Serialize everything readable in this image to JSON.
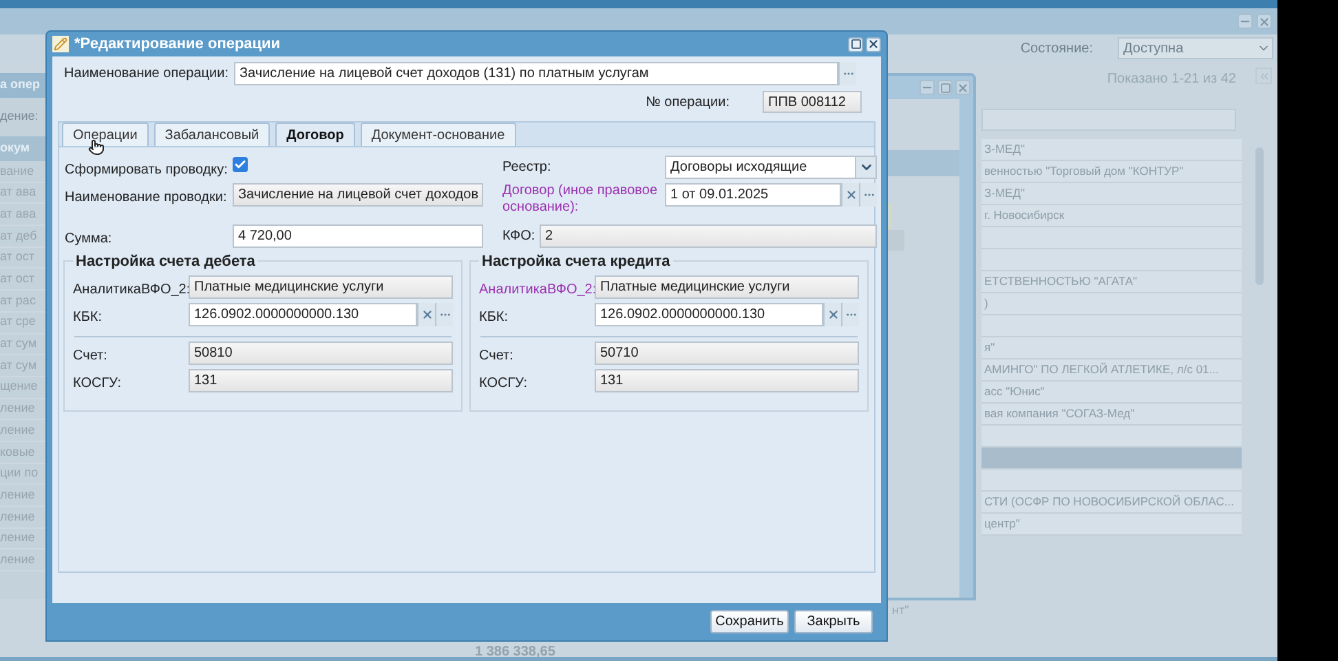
{
  "app": {
    "state_label": "Состояние:",
    "state_value": "Доступна",
    "shown": "Показано 1-21 из 42",
    "total": "1 386 338,65",
    "footer_text": "нт\""
  },
  "left_window": {
    "title": "а опер",
    "filter_label": "дение:",
    "header": "окум",
    "items": [
      "вание",
      "ат ава",
      "ат ава",
      "ат деб",
      "ат ост",
      "ат ост",
      "ат рас",
      "ат сре",
      "ат сум",
      "ат сум",
      "щение",
      "ление",
      "ление",
      "ковые",
      "ции по",
      "ление",
      "ление",
      "ление",
      "ление"
    ]
  },
  "list_rows": [
    {
      "text": "З-МЕД\"",
      "selected": false
    },
    {
      "text": "венностью \"Торговый дом \"КОНТУР\"",
      "selected": false
    },
    {
      "text": "З-МЕД\"",
      "selected": false
    },
    {
      "text": "г. Новосибирск",
      "selected": false
    },
    {
      "text": "",
      "selected": false
    },
    {
      "text": "",
      "selected": false
    },
    {
      "text": "ЕТСТВЕННОСТЬЮ \"АГАТА\"",
      "selected": false
    },
    {
      "text": ")",
      "selected": false
    },
    {
      "text": "",
      "selected": false
    },
    {
      "text": "я\"",
      "selected": false
    },
    {
      "text": "АМИНГО\" ПО ЛЕГКОЙ АТЛЕТИКЕ, л/с 01...",
      "selected": false
    },
    {
      "text": "асс \"Юнис\"",
      "selected": false
    },
    {
      "text": "вая компания \"СОГАЗ-Мед\"",
      "selected": false
    },
    {
      "text": "",
      "selected": false
    },
    {
      "text": "",
      "selected": true
    },
    {
      "text": "",
      "selected": false
    },
    {
      "text": "СТИ (ОСФР ПО НОВОСИБИРСКОЙ ОБЛАС...",
      "selected": false
    },
    {
      "text": "центр\"",
      "selected": false
    }
  ],
  "dialog": {
    "title": "*Редактирование операции",
    "operation_name_label": "Наименование операции:",
    "operation_name": "Зачисление на лицевой счет доходов (131) по платным услугам",
    "number_label": "№ операции:",
    "number": "ППВ 008112",
    "tabs": [
      {
        "label": "Операции",
        "selected": false
      },
      {
        "label": "Забалансовый",
        "selected": false
      },
      {
        "label": "Договор",
        "selected": true
      },
      {
        "label": "Документ-основание",
        "selected": false
      }
    ],
    "post_label": "Сформировать проводку:",
    "post_checked": true,
    "left_fields": [
      {
        "label": "Наименование проводки:",
        "value": "Зачисление на лицевой счет доходов",
        "kind": "readonly"
      },
      {
        "label": "Сумма:",
        "value": "4 720,00",
        "kind": "text"
      }
    ],
    "right_fields": [
      {
        "label": "Реестр:",
        "value": "Договоры исходящие",
        "kind": "select",
        "highlighted": false
      },
      {
        "label": "Договор (иное правовое основание):",
        "value": "1 от 09.01.2025",
        "kind": "lookup",
        "highlighted": true
      },
      {
        "label": "КФО:",
        "value": "2",
        "kind": "readonly",
        "highlighted": false
      }
    ],
    "sections": [
      {
        "title": "Настройка счета дебета",
        "fields": [
          {
            "label": "АналитикаВФО_2:",
            "value": "Платные медицинские услуги",
            "kind": "readonly",
            "highlighted": false
          },
          {
            "label": "КБК:",
            "value": "126.0902.0000000000.130",
            "kind": "lookup",
            "highlighted": false
          },
          {
            "label": "Счет:",
            "value": "50810",
            "kind": "readonly",
            "highlighted": false
          },
          {
            "label": "КОСГУ:",
            "value": "131",
            "kind": "readonly",
            "highlighted": false
          }
        ]
      },
      {
        "title": "Настройка счета кредита",
        "fields": [
          {
            "label": "АналитикаВФО_2:",
            "value": "Платные медицинские услуги",
            "kind": "readonly",
            "highlighted": true
          },
          {
            "label": "КБК:",
            "value": "126.0902.0000000000.130",
            "kind": "lookup",
            "highlighted": false
          },
          {
            "label": "Счет:",
            "value": "50710",
            "kind": "readonly",
            "highlighted": false
          },
          {
            "label": "КОСГУ:",
            "value": "131",
            "kind": "readonly",
            "highlighted": false
          }
        ]
      }
    ],
    "buttons": [
      "Сохранить",
      "Закрыть"
    ]
  }
}
